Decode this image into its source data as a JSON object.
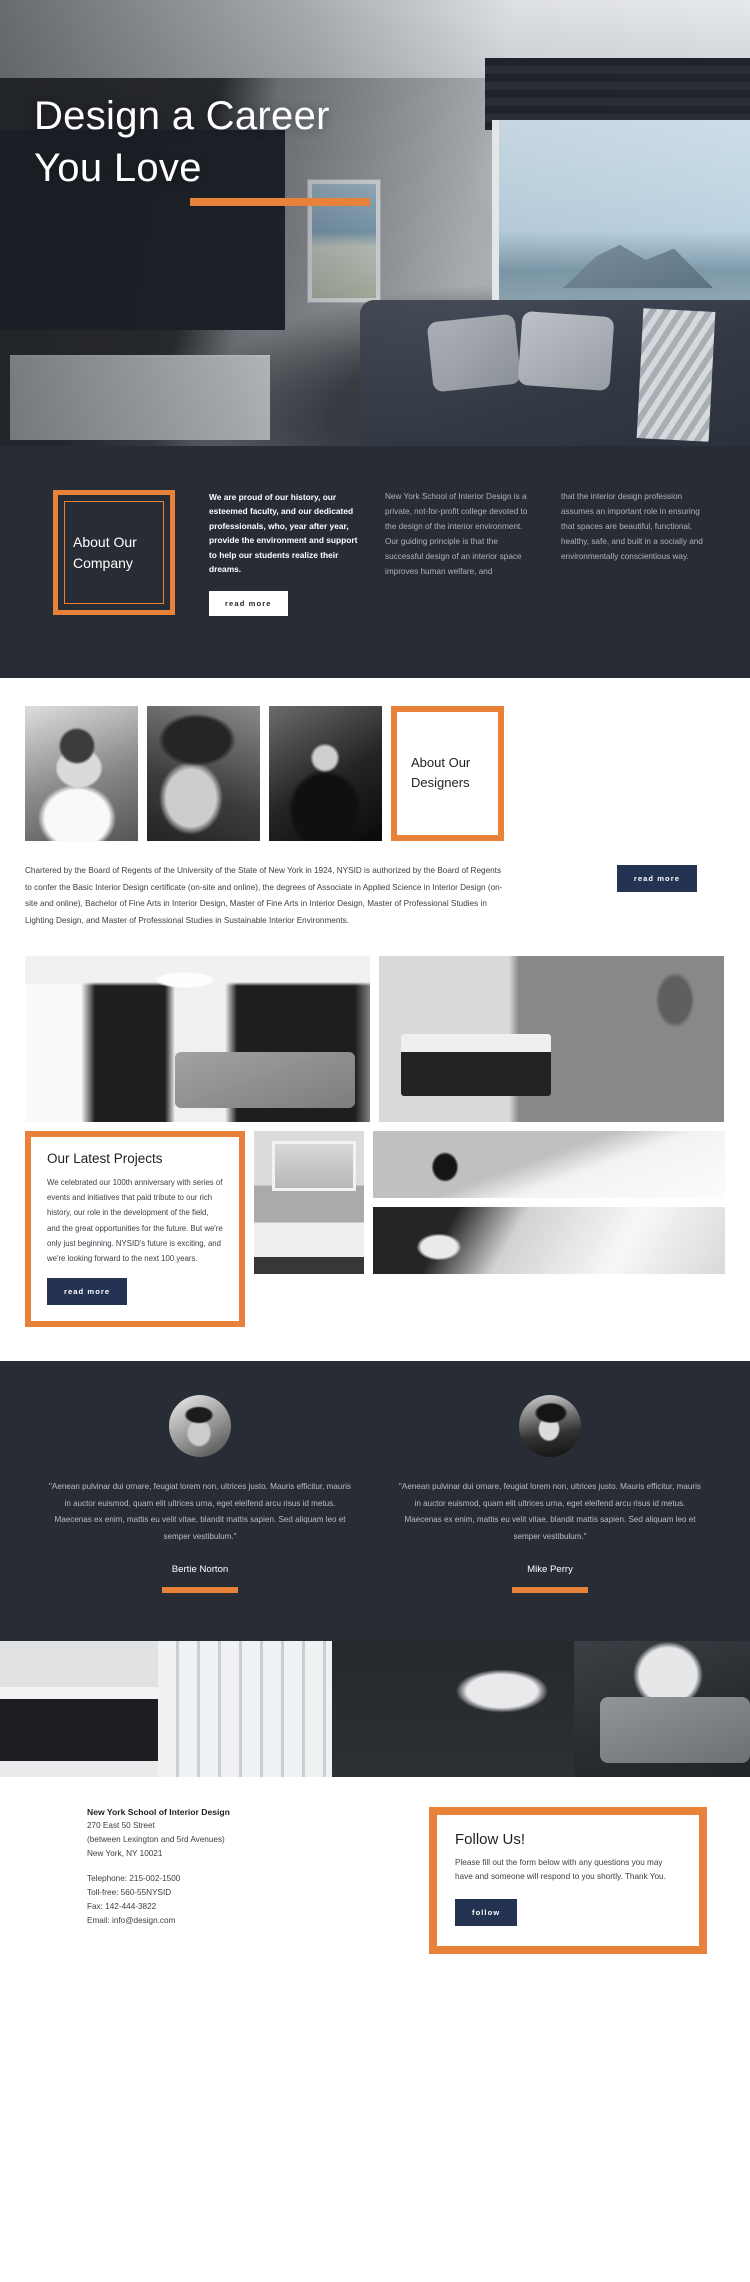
{
  "hero": {
    "title_line1": "Design a Career",
    "title_line2": "You Love",
    "accent_color": "#e8813a",
    "image_alt": "modern-living-room-with-ocean-view"
  },
  "about": {
    "frame_title": "About Our Company",
    "lead": "We are proud of our history, our esteemed faculty, and our dedicated professionals, who, year after year, provide the environment and support to help our students realize their dreams.",
    "read_more_label": "read more",
    "column_2": "New York School of Interior Design is a private, not-for-profit college devoted to the design of the interior environment. Our guiding principle is that the successful design of an interior space improves human welfare, and",
    "column_3": "that the interior design profession assumes an important role in ensuring that spaces are beautiful, functional, healthy, safe, and built in a socially and environmentally conscientious way.",
    "bg_color": "#282c35"
  },
  "designers": {
    "frame_title": "About Our Designers",
    "photos": [
      "portrait-woman-curly-hair",
      "portrait-young-man",
      "portrait-woman-jacket"
    ],
    "body": "Chartered by the Board of Regents of the University of the State of New York in 1924, NYSID is authorized by the Board of Regents to confer the Basic Interior Design certificate (on-site and online), the degrees of Associate in Applied Science in Interior Design (on-site and online), Bachelor of Fine Arts in Interior Design, Master of Fine Arts in Interior Design, Master of Professional Studies in Lighting Design, and Master of Professional Studies in Sustainable Interior Environments.",
    "read_more_label": "read more"
  },
  "projects": {
    "title": "Our Latest Projects",
    "body": "We celebrated our 100th anniversary with series of events and initiatives that paid tribute to our rich history, our role in the development of the field, and the great opportunities for the future. But we're only just beginning. NYSID's future is exciting, and we're looking forward to the next 100 years.",
    "read_more_label": "read more",
    "images": [
      "living-room-with-fireplace-and-ceiling-fan",
      "bedroom-with-desk-and-shelving",
      "bed-with-blanket-and-mug",
      "modern-glass-balcony-interior",
      "lounge-with-sofa-and-coffee-table"
    ]
  },
  "testimonials": [
    {
      "avatar": "portrait-woman-with-hat",
      "quote": "\"Aenean pulvinar dui ornare, feugiat lorem non, ultrices justo. Mauris efficitur, mauris in auctor euismod, quam elit ultrices urna, eget eleifend arcu risus id metus. Maecenas ex enim, mattis eu velit vitae, blandit mattis sapien. Sed aliquam leo et semper vestibulum.\"",
      "name": "Bertie Norton"
    },
    {
      "avatar": "portrait-man-in-suit",
      "quote": "\"Aenean pulvinar dui ornare, feugiat lorem non, ultrices justo. Mauris efficitur, mauris in auctor euismod, quam elit ultrices urna, eget eleifend arcu risus id metus. Maecenas ex enim, mattis eu velit vitae, blandit mattis sapien. Sed aliquam leo et semper vestibulum.\"",
      "name": "Mike Perry"
    }
  ],
  "strip": {
    "image_alt": "wide-living-room-panorama"
  },
  "footer": {
    "org": "New York School of Interior Design",
    "address_1": "270 East 50 Street",
    "address_2": "(between Lexington and 5rd Avenues)",
    "address_3": "New York, NY 10021",
    "telephone": "Telephone: 215-002-1500",
    "tollfree": "Toll-free: 560-55NYSID",
    "fax": "Fax: 142-444-3822",
    "email": "Email: info@design.com",
    "follow_title": "Follow Us!",
    "follow_body": "Please fill out the form below with any questions you may have and someone will respond to you shortly. Thank You.",
    "follow_label": "follow"
  }
}
